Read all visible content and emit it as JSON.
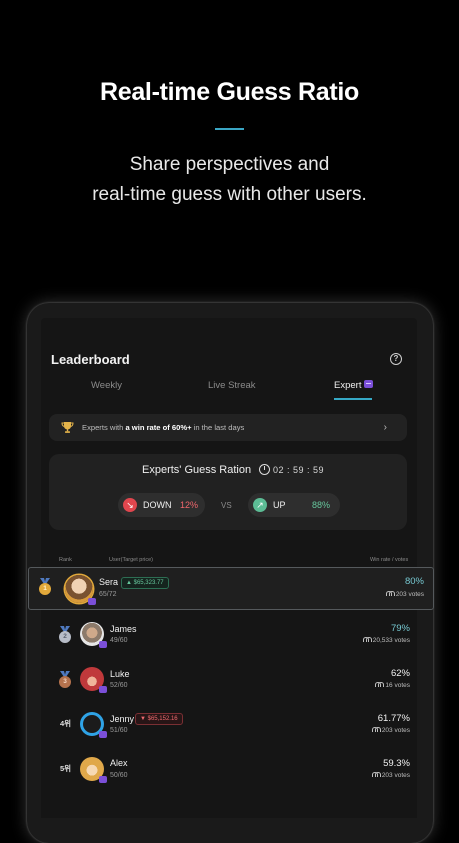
{
  "hero": {
    "title": "Real-time Guess Ratio",
    "subtitle_line1": "Share perspectives and",
    "subtitle_line2": "real-time guess with other users."
  },
  "leaderboard": {
    "title": "Leaderboard",
    "help_icon": "?",
    "tabs": [
      {
        "label": "Weekly",
        "active": false
      },
      {
        "label": "Live Streak",
        "active": false
      },
      {
        "label": "Expert",
        "active": true
      }
    ],
    "banner": {
      "text_prefix": "Experts with ",
      "text_bold": "a win rate of 60%+",
      "text_suffix": " in the last days",
      "arrow": "›"
    },
    "guess_card": {
      "title": "Experts' Guess Ration",
      "timer": "02 : 59 : 59",
      "down_label": "DOWN",
      "down_pct": "12%",
      "vs": "VS",
      "up_label": "UP",
      "up_pct": "88%"
    },
    "columns": {
      "rank": "Rank",
      "user": "User(Target price)",
      "win": "Win rate / votes"
    },
    "rows": [
      {
        "rank": "1",
        "name": "Sera",
        "price": "▲ $65,323.77",
        "price_dir": "up",
        "score": "65/72",
        "win_rate": "80%",
        "votes": "203 votes"
      },
      {
        "rank": "2",
        "name": "James",
        "price": "",
        "price_dir": "",
        "score": "49/60",
        "win_rate": "79%",
        "votes": "20,533 votes"
      },
      {
        "rank": "3",
        "name": "Luke",
        "price": "",
        "price_dir": "",
        "score": "52/60",
        "win_rate": "62%",
        "votes": "16 votes"
      },
      {
        "rank": "4위",
        "name": "Jenny",
        "price": "▼ $65,152.16",
        "price_dir": "down",
        "score": "51/60",
        "win_rate": "61.77%",
        "votes": "203 votes"
      },
      {
        "rank": "5위",
        "name": "Alex",
        "price": "",
        "price_dir": "",
        "score": "50/60",
        "win_rate": "59.3%",
        "votes": "203 votes"
      }
    ]
  },
  "colors": {
    "accent": "#36a9c6",
    "up": "#67c79d",
    "down": "#ef6a6f",
    "expert_badge": "#7b4fd8"
  }
}
